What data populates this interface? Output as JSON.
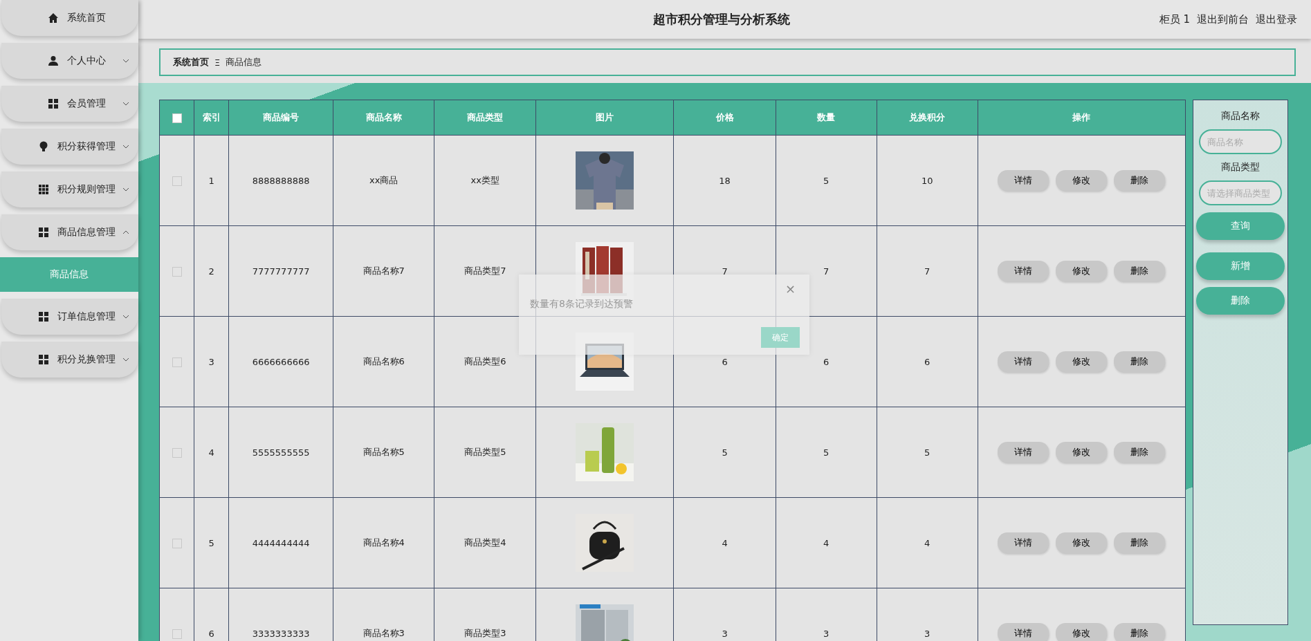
{
  "sidebar": {
    "items": [
      {
        "label": "系统首页"
      },
      {
        "label": "个人中心",
        "expanded": false
      },
      {
        "label": "会员管理",
        "expanded": false
      },
      {
        "label": "积分获得管理",
        "expanded": false
      },
      {
        "label": "积分规则管理",
        "expanded": false
      },
      {
        "label": "商品信息管理",
        "expanded": true,
        "children": [
          {
            "label": "商品信息",
            "selected": true
          }
        ]
      },
      {
        "label": "订单信息管理",
        "expanded": false
      },
      {
        "label": "积分兑换管理",
        "expanded": false
      }
    ]
  },
  "header": {
    "title": "超市积分管理与分析系统",
    "user": "柜员 1",
    "links": [
      "退出到前台",
      "退出登录"
    ]
  },
  "breadcrumb": {
    "items": [
      "系统首页",
      "商品信息"
    ],
    "separator": "Ξ"
  },
  "table": {
    "select_all": {
      "checked": false
    },
    "columns": [
      "索引",
      "商品编号",
      "商品名称",
      "商品类型",
      "图片",
      "价格",
      "数量",
      "兑换积分",
      "操作"
    ],
    "rows": [
      {
        "checked": false,
        "index": "1",
        "code": "8888888888",
        "name": "xx商品",
        "type": "xx类型",
        "price": "18",
        "quantity": "5",
        "points": "10",
        "actions": [
          "详情",
          "修改",
          "删除"
        ]
      },
      {
        "checked": false,
        "index": "2",
        "code": "7777777777",
        "name": "商品名称7",
        "type": "商品类型7",
        "price": "7",
        "quantity": "7",
        "points": "7",
        "actions": [
          "详情",
          "修改",
          "删除"
        ]
      },
      {
        "checked": false,
        "index": "3",
        "code": "6666666666",
        "name": "商品名称6",
        "type": "商品类型6",
        "price": "6",
        "quantity": "6",
        "points": "6",
        "actions": [
          "详情",
          "修改",
          "删除"
        ]
      },
      {
        "checked": false,
        "index": "4",
        "code": "5555555555",
        "name": "商品名称5",
        "type": "商品类型5",
        "price": "5",
        "quantity": "5",
        "points": "5",
        "actions": [
          "详情",
          "修改",
          "删除"
        ]
      },
      {
        "checked": false,
        "index": "5",
        "code": "4444444444",
        "name": "商品名称4",
        "type": "商品类型4",
        "price": "4",
        "quantity": "4",
        "points": "4",
        "actions": [
          "详情",
          "修改",
          "删除"
        ]
      },
      {
        "checked": false,
        "index": "6",
        "code": "3333333333",
        "name": "商品名称3",
        "type": "商品类型3",
        "price": "3",
        "quantity": "3",
        "points": "3",
        "actions": [
          "详情",
          "修改",
          "删除"
        ]
      }
    ]
  },
  "search_panel": {
    "fields": [
      {
        "label": "商品名称",
        "placeholder": "商品名称"
      },
      {
        "label": "商品类型",
        "placeholder": "请选择商品类型"
      }
    ],
    "buttons": [
      "查询",
      "新增",
      "删除"
    ]
  },
  "dialog": {
    "message": "数量有8条记录到达预警",
    "close": "×",
    "confirm": "确定"
  }
}
